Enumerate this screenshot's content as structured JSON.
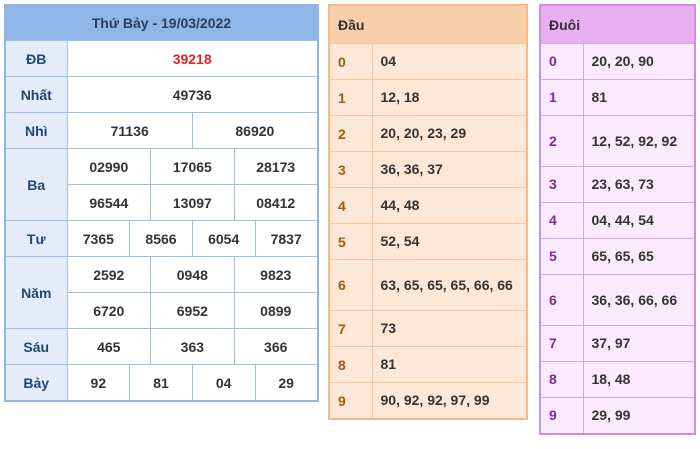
{
  "results": {
    "header": "Thứ Bảy - 19/03/2022",
    "labels": {
      "db": "ĐB",
      "nhat": "Nhất",
      "nhi": "Nhì",
      "ba": "Ba",
      "tu": "Tư",
      "nam": "Năm",
      "sau": "Sáu",
      "bay": "Bảy"
    },
    "db": "39218",
    "nhat": "49736",
    "nhi": [
      "71136",
      "86920"
    ],
    "ba": [
      "02990",
      "17065",
      "28173",
      "96544",
      "13097",
      "08412"
    ],
    "tu": [
      "7365",
      "8566",
      "6054",
      "7837"
    ],
    "nam": [
      "2592",
      "0948",
      "9823",
      "6720",
      "6952",
      "0899"
    ],
    "sau": [
      "465",
      "363",
      "366"
    ],
    "bay": [
      "92",
      "81",
      "04",
      "29"
    ],
    "db_color": "#e02424"
  },
  "dau": {
    "header": "Đầu",
    "rows": [
      {
        "k": "0",
        "v": "04"
      },
      {
        "k": "1",
        "v": "12, 18"
      },
      {
        "k": "2",
        "v": "20, 20, 23, 29"
      },
      {
        "k": "3",
        "v": "36, 36, 37"
      },
      {
        "k": "4",
        "v": "44, 48"
      },
      {
        "k": "5",
        "v": "52, 54"
      },
      {
        "k": "6",
        "v": "63, 65, 65, 65, 66, 66"
      },
      {
        "k": "7",
        "v": "73"
      },
      {
        "k": "8",
        "v": "81"
      },
      {
        "k": "9",
        "v": "90, 92, 92, 97, 99"
      }
    ]
  },
  "duoi": {
    "header": "Đuôi",
    "rows": [
      {
        "k": "0",
        "v": "20, 20, 90"
      },
      {
        "k": "1",
        "v": "81"
      },
      {
        "k": "2",
        "v": "12, 52, 92, 92"
      },
      {
        "k": "3",
        "v": "23, 63, 73"
      },
      {
        "k": "4",
        "v": "04, 44, 54"
      },
      {
        "k": "5",
        "v": "65, 65, 65"
      },
      {
        "k": "6",
        "v": "36, 36, 66, 66"
      },
      {
        "k": "7",
        "v": "37, 97"
      },
      {
        "k": "8",
        "v": "18, 48"
      },
      {
        "k": "9",
        "v": "29, 99"
      }
    ]
  }
}
